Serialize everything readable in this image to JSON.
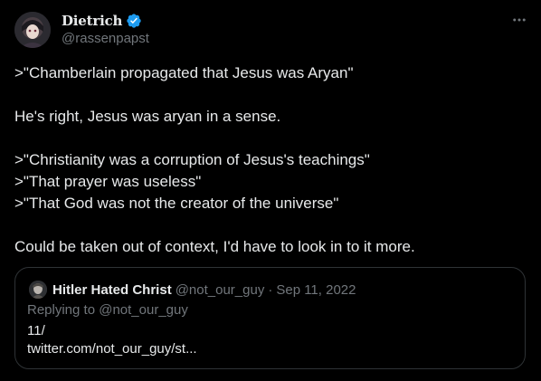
{
  "author": {
    "display_name": "Dietrich",
    "handle": "@rassenpapst",
    "verified": true,
    "avatar_icon": "anime-avatar-icon"
  },
  "menu": {
    "icon": "more-horizontal-icon"
  },
  "tweet_lines": [
    ">\"Chamberlain propagated that Jesus was Aryan\"",
    "",
    "He's right, Jesus was aryan in a sense.",
    "",
    ">\"Christianity was a corruption of Jesus's teachings\"",
    ">\"That prayer was useless\"",
    ">\"That God was not the creator of the universe\"",
    "",
    "Could be taken out of context, I'd have to look in to it more."
  ],
  "quote": {
    "display_name": "Hitler Hated Christ",
    "handle": "@not_our_guy",
    "separator": "·",
    "date": "Sep 11, 2022",
    "replying_prefix": "Replying to",
    "replying_to": "@not_our_guy",
    "body_line1": "11/",
    "body_line2": "twitter.com/not_our_guy/st..."
  },
  "colors": {
    "background": "#000000",
    "text": "#e7e9ea",
    "secondary": "#71767b",
    "verified": "#1d9bf0",
    "border": "#2f3336"
  }
}
